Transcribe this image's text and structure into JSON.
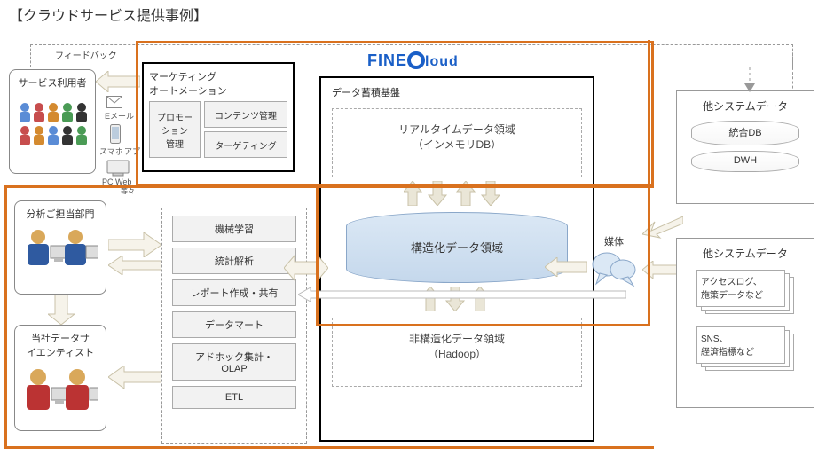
{
  "title": "【クラウドサービス提供事例】",
  "feedback_label": "フィードバック",
  "users_box": "サービス利用者",
  "channels": {
    "email": "Eメール",
    "phone": "スマホ",
    "app": "アプリ",
    "pcweb": "PC Web",
    "etc": "等々"
  },
  "marketing": {
    "group_title": "マーケティング\nオートメーション",
    "promo": "プロモー\nション\n管理",
    "content": "コンテンツ管理",
    "targeting": "ターゲティング"
  },
  "analysis": {
    "dept": "分析ご担当部門",
    "scientist": "当社データサ\nイエンティスト",
    "items": [
      "機械学習",
      "統計解析",
      "レポート作成・共有",
      "データマート",
      "アドホック集計・\nOLAP",
      "ETL"
    ]
  },
  "platform": {
    "brand": "FINEQloud",
    "title": "データ蓄積基盤",
    "realtime": "リアルタイムデータ領域\n（インメモリDB）",
    "structured": "構造化データ領域",
    "unstructured": "非構造化データ領域\n（Hadoop）",
    "media": "媒体"
  },
  "ext1": {
    "title": "他システムデータ",
    "dbs": [
      "統合DB",
      "DWH"
    ]
  },
  "ext2": {
    "title": "他システムデータ",
    "docs": [
      "アクセスログ、\n施策データなど",
      "SNS、\n経済指標など"
    ]
  }
}
